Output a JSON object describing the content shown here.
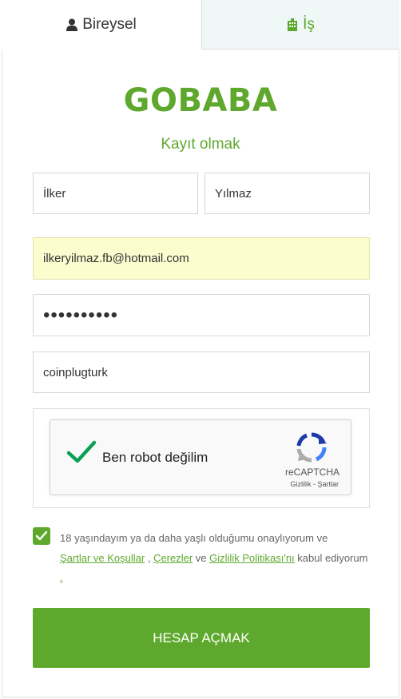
{
  "tabs": {
    "personal": {
      "label": "Bireysel",
      "icon": "user-icon"
    },
    "business": {
      "label": "İş",
      "icon": "building-icon"
    }
  },
  "brand": {
    "logo": "GOBABA",
    "subtitle": "Kayıt olmak",
    "accent": "#5ea92d"
  },
  "form": {
    "first_name": "İlker",
    "last_name": "Yılmaz",
    "email": "ilkeryilmaz.fb@hotmail.com",
    "password": "••••••••••",
    "referral": "coinplugturk"
  },
  "captcha": {
    "label": "Ben robot değilim",
    "brand": "reCAPTCHA",
    "privacy": "Gizlilik",
    "separator": " - ",
    "terms": "Şartlar"
  },
  "consent": {
    "text_before": "18 yaşındayım ya da daha yaşlı olduğumu onaylıyorum ve",
    "terms_link": "Şartlar ve Koşullar",
    "sep1": " , ",
    "cookies_link": "Çerezler",
    "sep2": " ve ",
    "privacy_link": "Gizlilik Politikası'nı",
    "text_after": " kabul ediyorum ",
    "period_link": "."
  },
  "submit_label": "HESAP AÇMAK"
}
